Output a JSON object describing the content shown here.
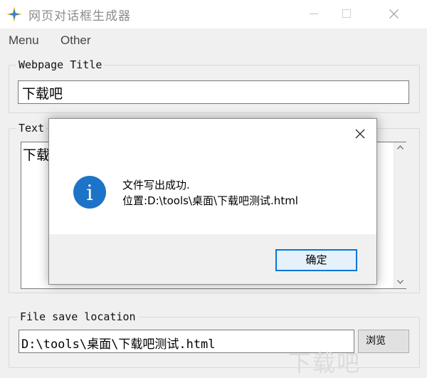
{
  "window": {
    "title": "网页对话框生成器",
    "accent_color": "#0078d7"
  },
  "menu": [
    {
      "label": "Menu"
    },
    {
      "label": "Other"
    }
  ],
  "webpage_title": {
    "label": "Webpage Title",
    "value": "下载吧"
  },
  "text": {
    "label": "Text",
    "value": "下载"
  },
  "file_save": {
    "label": "File save location",
    "value": "D:\\tools\\桌面\\下载吧测试.html",
    "browse_label": "浏览"
  },
  "message_box": {
    "icon": "info-icon",
    "line1": "文件写出成功.",
    "line2": "位置:D:\\tools\\桌面\\下载吧测试.html",
    "ok_label": "确定"
  },
  "watermark": "下载吧"
}
